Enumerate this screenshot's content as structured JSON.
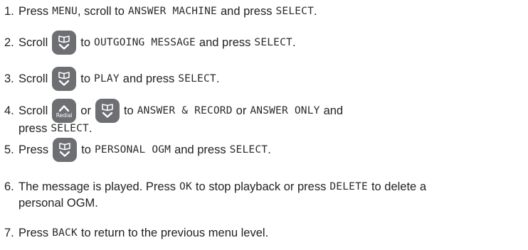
{
  "steps": [
    {
      "num": "1.",
      "t1": "Press",
      "k1": "MENU",
      "t2": ", scroll  to",
      "k2": "ANSWER MACHINE",
      "t3": "and press",
      "k3": "SELECT",
      "t4": "."
    },
    {
      "num": "2.",
      "t1": "Scroll",
      "t2": "to",
      "k1": "OUTGOING MESSAGE",
      "t3": "and press",
      "k2": "SELECT",
      "t4": ".",
      "button_icon": "down-arrow-phonebook-icon"
    },
    {
      "num": "3.",
      "t1": "Scroll",
      "t2": "to",
      "k1": "PLAY",
      "t3": "and press",
      "k2": "SELECT",
      "t4": ".",
      "button_icon": "down-arrow-phonebook-icon"
    },
    {
      "num": "4.",
      "t1": "Scroll",
      "redial_label": "Redial",
      "t2": "or",
      "t3": "to",
      "k1": "ANSWER & RECORD",
      "t4": "or",
      "k2": "ANSWER ONLY",
      "t5": "and",
      "t6": "press",
      "k3": "SELECT",
      "t7": "."
    },
    {
      "num": "5.",
      "t1": "Press",
      "t2": "to",
      "k1": "PERSONAL OGM",
      "t3": "and press",
      "k2": "SELECT",
      "t4": ".",
      "button_icon": "down-arrow-phonebook-icon"
    },
    {
      "num": "6.",
      "t1": "The message is played. Press",
      "k1": "OK",
      "t2": "to stop playback or press",
      "k2": "DELETE",
      "t3": "to delete a",
      "t4": "personal OGM."
    },
    {
      "num": "7.",
      "t1": "Press",
      "k1": "BACK",
      "t2": "to return to the previous menu level."
    }
  ],
  "colors": {
    "text": "#222222",
    "button_bg": "#6d6f73",
    "button_fg": "#ffffff"
  }
}
